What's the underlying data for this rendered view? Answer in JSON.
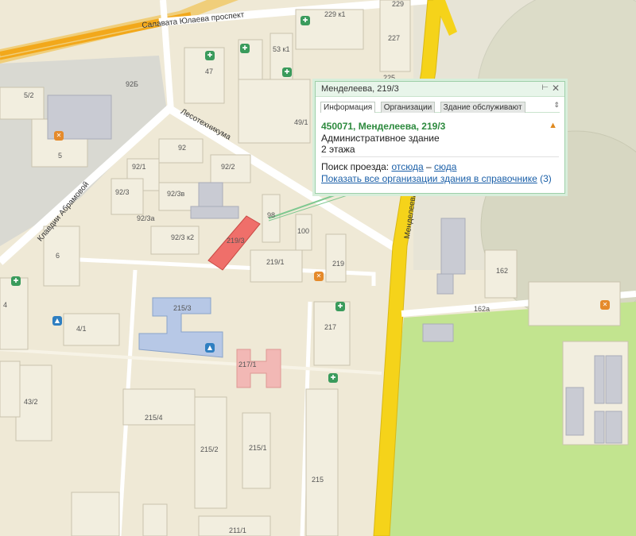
{
  "roads": {
    "salavata": "Салавата Юлаева проспект",
    "lesotekh": "Лесотехникума",
    "abramova": "Клавдии Абрамовой",
    "mendeleeva": "Менделеева"
  },
  "buildings": [
    "229",
    "229 к1",
    "227",
    "225",
    "53 к1",
    "47",
    "49/1",
    "5/2",
    "92Б",
    "92",
    "92/1",
    "92/2",
    "92/3",
    "92/3в",
    "92/3а",
    "92/3 к2",
    "219/3",
    "98",
    "100",
    "219/1",
    "219",
    "5",
    "6",
    "4",
    "4/1",
    "215/3",
    "217",
    "217/1",
    "43/2",
    "215/4",
    "215/2",
    "215/1",
    "215",
    "211/1",
    "162",
    "162а"
  ],
  "popup": {
    "title": "Менделеева, 219/3",
    "tabs": [
      "Информация",
      "Организации",
      "Здание обслуживают"
    ],
    "address": "450071, Менделеева, 219/3",
    "type": "Административное здание",
    "floors": "2 этажа",
    "route_label": "Поиск проезда:",
    "route_from": "отсюда",
    "route_dash": "–",
    "route_to": "сюда",
    "all_orgs": "Показать все организации здания в справочнике",
    "all_orgs_count": "(3)"
  },
  "colors": {
    "highway": "#f2a81b",
    "main_road": "#f5d31a",
    "park": "#c2e48f",
    "highlight": "#ef6f6a",
    "popup_border": "#9ecfa8"
  }
}
